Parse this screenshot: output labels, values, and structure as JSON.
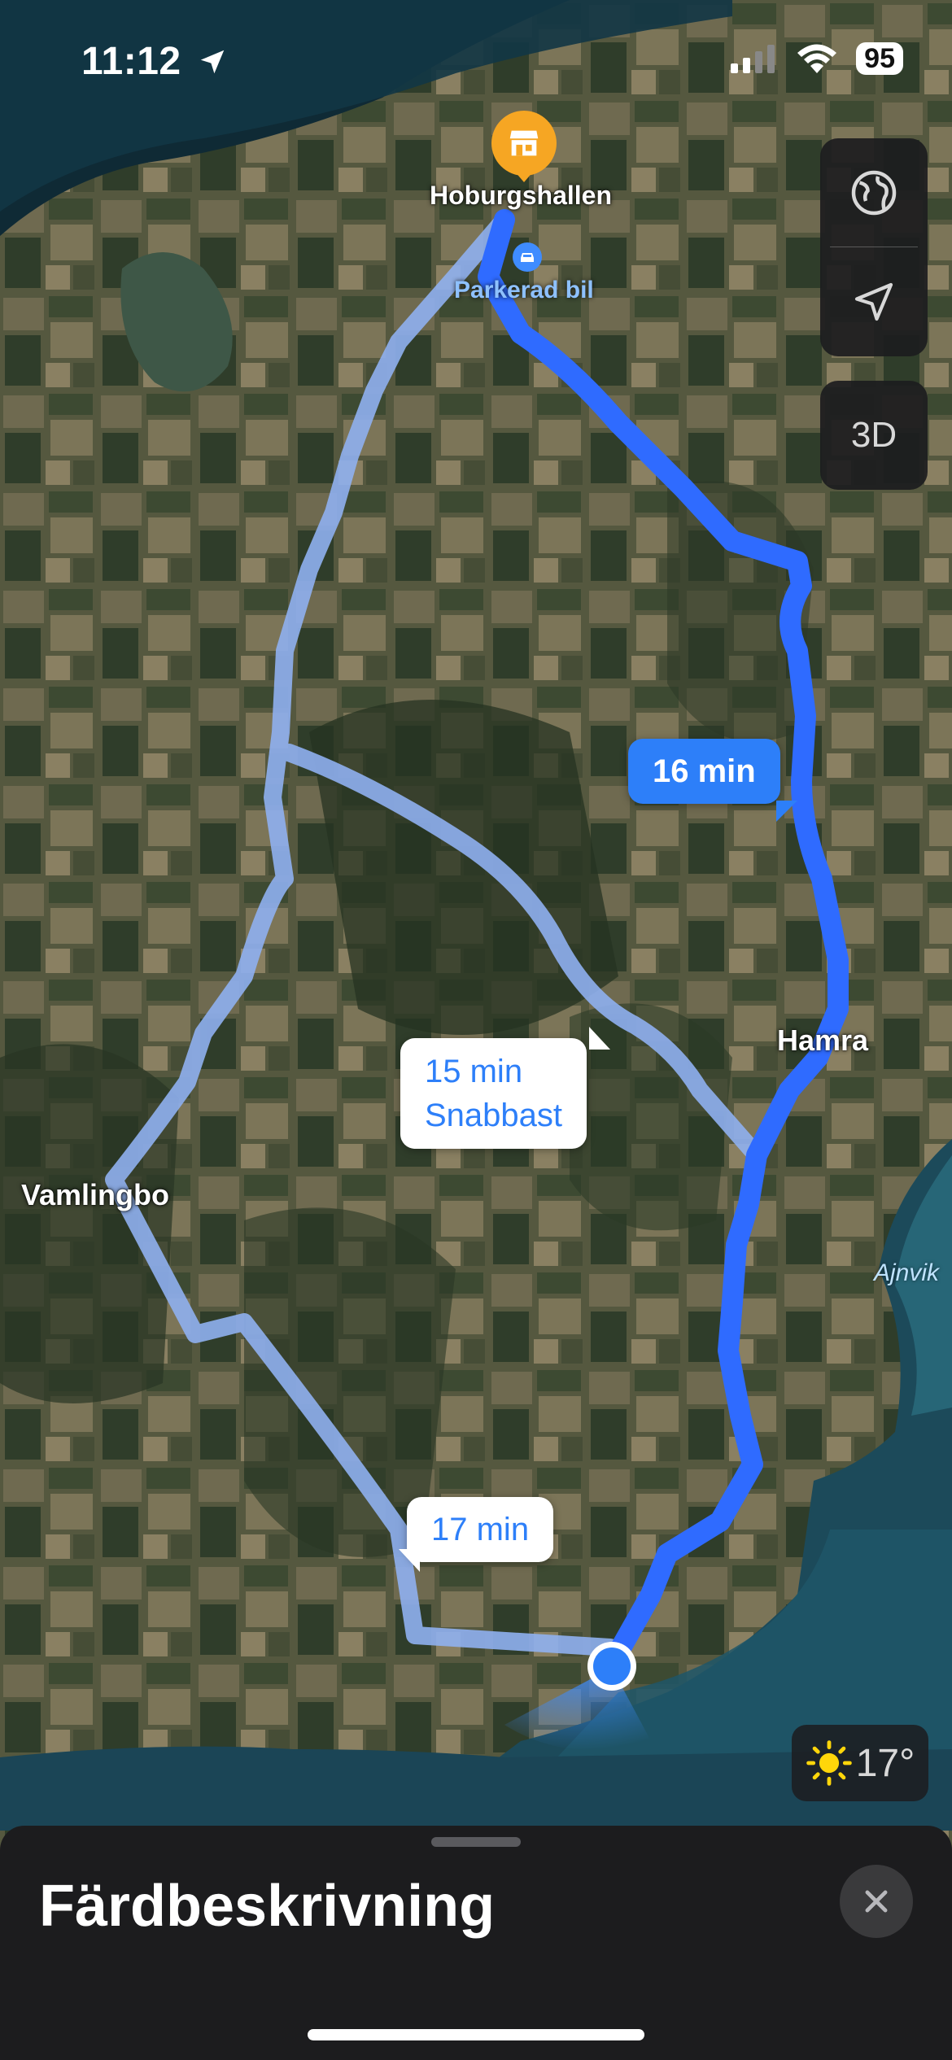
{
  "status_bar": {
    "time": "11:12",
    "battery": "95"
  },
  "map": {
    "places": {
      "hoburgshallen": "Hoburgshallen",
      "parked_car": "Parkerad bil",
      "hamra": "Hamra",
      "vamlingbo": "Vamlingbo",
      "ajnvik": "Ajnvik"
    },
    "routes": [
      {
        "time": "16 min",
        "selected": true
      },
      {
        "time": "15 min",
        "note": "Snabbast",
        "selected": false
      },
      {
        "time": "17 min",
        "selected": false
      }
    ],
    "controls": {
      "three_d_label": "3D"
    }
  },
  "weather": {
    "temperature": "17°",
    "icon": "sun-icon"
  },
  "sheet": {
    "title": "Färdbeskrivning"
  },
  "colors": {
    "route_selected": "#2f6bff",
    "route_alt": "#8fb0f0",
    "accent": "#2d7ff9"
  }
}
